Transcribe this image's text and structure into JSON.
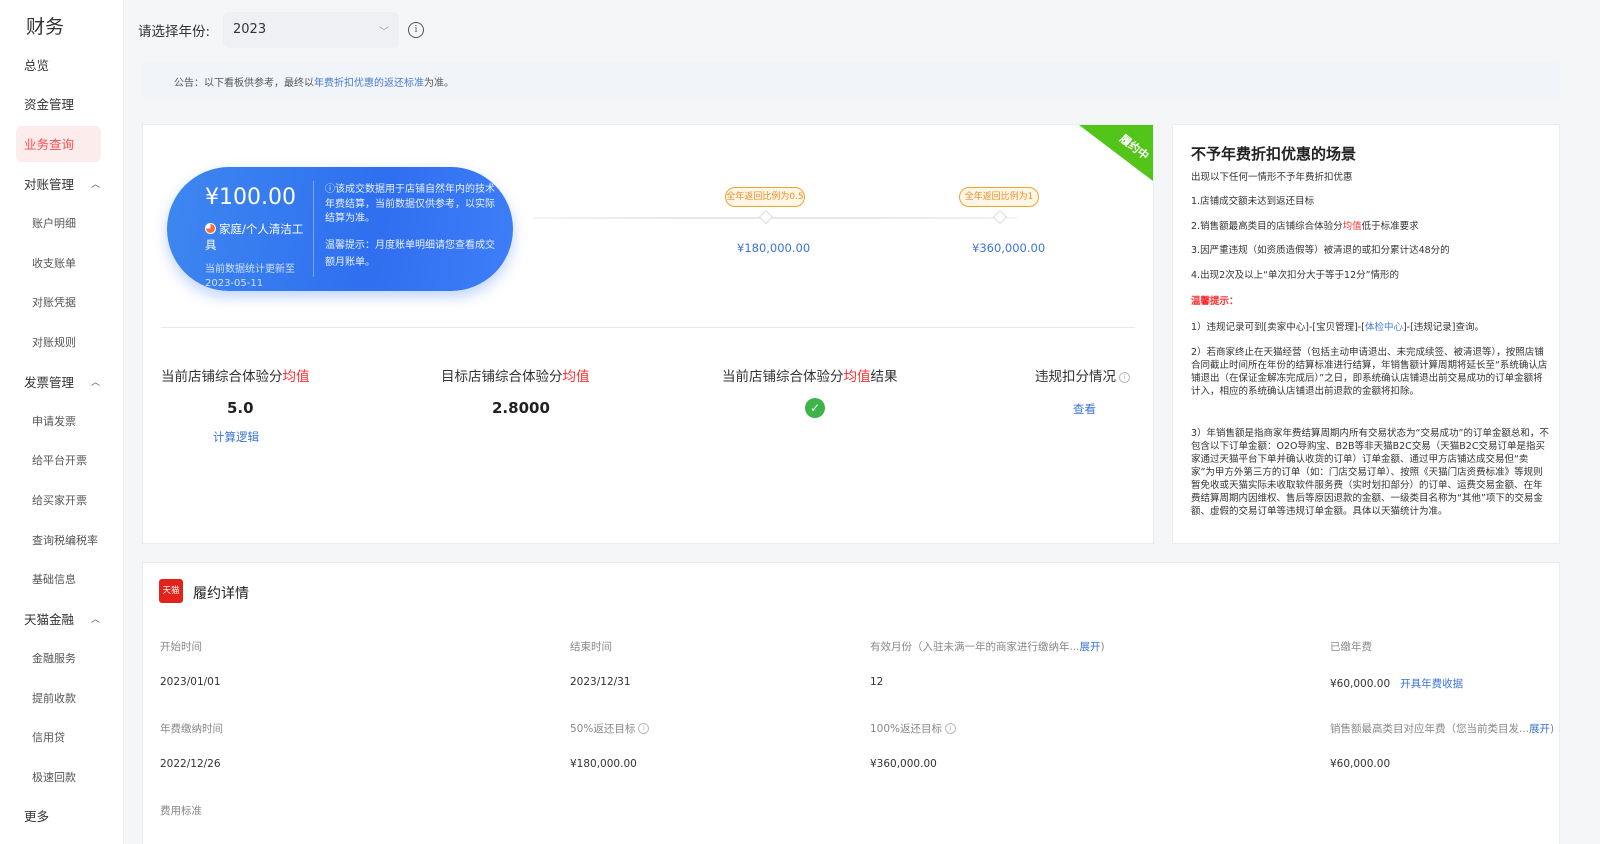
{
  "sidebar": {
    "title": "财务",
    "overview": "总览",
    "funds": "资金管理",
    "business_query": "业务查询",
    "reconciliation": {
      "label": "对账管理",
      "items": [
        "账户明细",
        "收支账单",
        "对账凭据",
        "对账规则"
      ]
    },
    "invoice": {
      "label": "发票管理",
      "items": [
        "申请发票",
        "给平台开票",
        "给买家开票",
        "查询税编税率",
        "基础信息"
      ]
    },
    "finance": {
      "label": "天猫金融",
      "items": [
        "金融服务",
        "提前收款",
        "信用贷",
        "极速回款"
      ]
    },
    "more": "更多"
  },
  "topbar": {
    "year_label": "请选择年份:",
    "year_value": "2023"
  },
  "notice": {
    "prefix": "公告：以下看板供参考，最终以",
    "link": "年费折扣优惠的返还标准",
    "suffix": "为准。"
  },
  "status_ribbon": "履约中",
  "summary": {
    "amount": "¥100.00",
    "category": "家庭/个人清洁工具",
    "updated": "当前数据统计更新至 2023-05-11",
    "note": "ⓘ该成交数据用于店铺自然年内的技术年费结算，当前数据仅供参考，以实际结算为准。",
    "tip": "温馨提示：月度账单明细请您查看成交额月账单。"
  },
  "milestones": [
    {
      "label": "全年返回比例为0.5",
      "amount": "¥180,000.00"
    },
    {
      "label": "全年返回比例为1",
      "amount": "¥360,000.00"
    }
  ],
  "metrics": {
    "current_avg": {
      "pre": "当前店铺综合体验分",
      "red": "均值",
      "post": "",
      "value": "5.0",
      "link": "计算逻辑"
    },
    "target_avg": {
      "pre": "目标店铺综合体验分",
      "red": "均值",
      "post": "",
      "value": "2.8000"
    },
    "result": {
      "pre": "当前店铺综合体验分",
      "red": "均值",
      "post": "结果"
    },
    "violation": {
      "label": "违规扣分情况",
      "link": "查看"
    }
  },
  "right_panel": {
    "title": "不予年费折扣优惠的场景",
    "intro": "出现以下任何一情形不予年费折扣优惠",
    "items": [
      "1.店铺成交额未达到返还目标",
      "2.销售额最高类目的店铺综合体验分",
      "3.因严重违规（如资质造假等）被清退的或扣分累计达48分的",
      "4.出现2次及以上“单次扣分大于等于12分”情形的"
    ],
    "item2_red": "均值",
    "item2_suffix": "低于标准要求",
    "warn_title": "温馨提示：",
    "tip1_pre": "1）违规记录可到[卖家中心]-[宝贝管理]-[",
    "tip1_link": "体检中心",
    "tip1_post": "]-[违规记录]查询。",
    "tip2": "2）若商家终止在天猫经营（包括主动申请退出、未完成续签、被清退等），按照店铺合同截止时间所在年份的结算标准进行结算，年销售额计算周期将延长至“系统确认店铺退出（在保证金解冻完成后）”之日，即系统确认店铺退出前交易成功的订单金额将计入，相应的系统确认店铺退出前退款的金额将扣除。",
    "tip3": "3）年销售额是指商家年费结算周期内所有交易状态为“交易成功”的订单金额总和，不包含以下订单金额：O2O导购宝、B2B等非天猫B2C交易（天猫B2C交易订单是指买家通过天猫平台下单并确认收货的订单）订单金额、通过甲方店铺达成交易但“卖家”为甲方外第三方的订单（如：门店交易订单）、按照《天猫门店资费标准》等规则暂免收或天猫实际未收取软件服务费（实时划扣部分）的订单、运费交易金额、在年费结算周期内因维权、售后等原因退款的金额、一级类目名称为“其他”项下的交易金额、虚假的交易订单等违规订单金额。具体以天猫统计为准。"
  },
  "detail": {
    "logo_text": "天猫",
    "title": "履约详情",
    "row1": {
      "labels": [
        "开始时间",
        "结束时间",
        "有效月份（入驻未满一年的商家进行缴纳年...",
        "已缴年费"
      ],
      "expand": "展开",
      "values": [
        "2023/01/01",
        "2023/12/31",
        "12",
        "¥60,000.00"
      ],
      "receipt_link": "开具年费收据"
    },
    "row2": {
      "labels": [
        "年费缴纳时间",
        "50%返还目标",
        "100%返还目标",
        "销售额最高类目对应年费（您当前类目发..."
      ],
      "expand": "展开",
      "values": [
        "2022/12/26",
        "¥180,000.00",
        "¥360,000.00",
        "¥60,000.00"
      ]
    },
    "row3_label": "费用标准"
  }
}
